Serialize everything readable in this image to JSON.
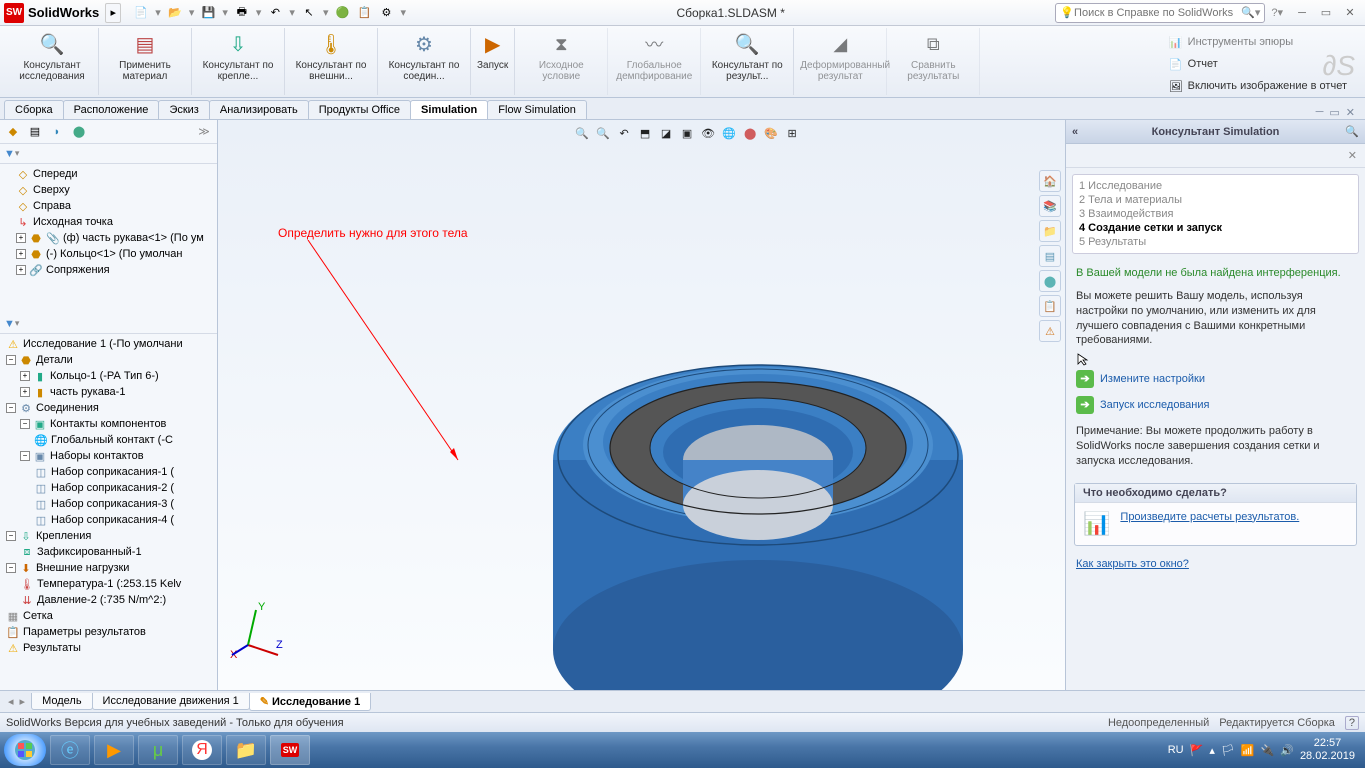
{
  "title": "Сборка1.SLDASM *",
  "app_name": "SolidWorks",
  "search_placeholder": "Поиск в Справке по SolidWorks",
  "ribbon": {
    "g1": "Консультант исследования",
    "g2": "Применить материал",
    "g3": "Консультант по крепле...",
    "g4": "Консультант по внешни...",
    "g5": "Консультант по соедин...",
    "g6": "Запуск",
    "g7": "Исходное условие",
    "g8": "Глобальное демпфирование",
    "g9": "Консультант по результ...",
    "g10": "Деформированный результат",
    "g11": "Сравнить результаты",
    "r1": "Инструменты эпюры",
    "r2": "Отчет",
    "r3": "Включить изображение в отчет"
  },
  "tabs": [
    "Сборка",
    "Расположение",
    "Эскиз",
    "Анализировать",
    "Продукты Office",
    "Simulation",
    "Flow Simulation"
  ],
  "active_tab": 5,
  "tree_top": {
    "items": [
      "Спереди",
      "Сверху",
      "Справа",
      "Исходная точка",
      "(ф) часть рукава<1> (По ум",
      "(-) Кольцо<1> (По умолчан",
      "Сопряжения"
    ]
  },
  "study_tree": {
    "study": "Исследование 1 (-По умолчани",
    "parts": "Детали",
    "part1": "Кольцо-1 (-РА Тип 6-)",
    "part2": "часть рукава-1",
    "connections": "Соединения",
    "comp_contacts": "Контакты компонентов",
    "global_contact": "Глобальный контакт (-С",
    "contact_sets": "Наборы контактов",
    "cs1": "Набор соприкасания-1 (",
    "cs2": "Набор соприкасания-2 (",
    "cs3": "Набор соприкасания-3 (",
    "cs4": "Набор соприкасания-4 (",
    "fixtures": "Крепления",
    "fix1": "Зафиксированный-1",
    "loads": "Внешние нагрузки",
    "temp": "Температура-1 (:253.15 Kelv",
    "press": "Давление-2 (:735 N/m^2:)",
    "mesh": "Сетка",
    "res_opts": "Параметры результатов",
    "results": "Результаты"
  },
  "annotation": "Определить нужно для этого тела",
  "consultant": {
    "title": "Консультант Simulation",
    "steps": {
      "s1": "1  Исследование",
      "s2": "2  Тела и материалы",
      "s3": "3  Взаимодействия",
      "s4": "4  Создание сетки и запуск",
      "s5": "5  Результаты"
    },
    "green_msg": "В Вашей модели не была найдена интерференция.",
    "body1": "Вы можете решить Вашу модель, используя настройки по умолчанию, или изменить их для лучшего совпадения с Вашими конкретными требованиями.",
    "action1": "Измените настройки",
    "action2": "Запуск исследования",
    "note": "Примечание: Вы можете продолжить работу в SolidWorks после завершения создания сетки и запуска исследования.",
    "box_title": "Что необходимо сделать?",
    "box_link": "Произведите расчеты результатов.",
    "close_link": "Как закрыть это окно?"
  },
  "bottom_tabs": {
    "t1": "Модель",
    "t2": "Исследование движения 1",
    "t3": "Исследование 1"
  },
  "status": {
    "left": "SolidWorks Версия для учебных заведений - Только для обучения",
    "s1": "Недоопределенный",
    "s2": "Редактируется Сборка"
  },
  "tray": {
    "lang": "RU",
    "time": "22:57",
    "date": "28.02.2019"
  }
}
